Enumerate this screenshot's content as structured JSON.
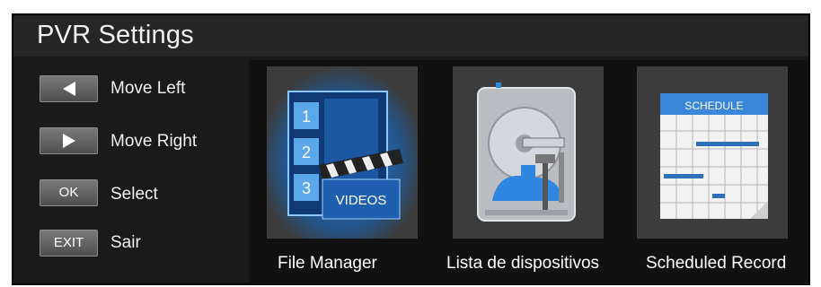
{
  "header": {
    "title": "PVR Settings"
  },
  "controls": [
    {
      "key": "",
      "icon": "triangle-left-icon",
      "label": "Move Left"
    },
    {
      "key": "",
      "icon": "triangle-right-icon",
      "label": "Move Right"
    },
    {
      "key": "OK",
      "label": "Select"
    },
    {
      "key": "EXIT",
      "label": "Sair"
    }
  ],
  "tiles": [
    {
      "label": "File Manager",
      "icon": "video-file-manager-icon",
      "icon_text": [
        "1",
        "2",
        "3",
        "VIDEOS"
      ]
    },
    {
      "label": "Lista de dispositivos",
      "icon": "hard-drive-tools-icon"
    },
    {
      "label": "Scheduled Record",
      "icon": "schedule-calendar-icon",
      "icon_text": "SCHEDULE"
    }
  ],
  "colors": {
    "panel": "#1a1a1a",
    "title_bar": "#262626",
    "highlight_glow": "#3aa0ff",
    "key": "#666666"
  }
}
